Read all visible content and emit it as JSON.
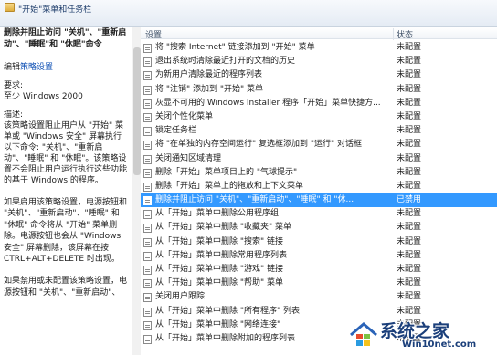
{
  "breadcrumb": {
    "title": "\"开始\"菜单和任务栏"
  },
  "description": {
    "heading": "删除并阻止访问 \"关机\"、\"重新启动\"、\"睡眠\"和 \"休眠\"命令",
    "edit_prefix": "编辑",
    "edit_link": "策略设置",
    "requirements_label": "要求:",
    "requirements_value": "至少 Windows 2000",
    "description_label": "描述:",
    "description_text": "该策略设置阻止用户从 \"开始\" 菜单或 \"Windows 安全\" 屏幕执行以下命令: \"关机\"、\"重新启动\"、\"睡眠\" 和 \"休眠\"。该策略设置不会阻止用户运行执行这些功能的基于 Windows 的程序。",
    "enable_text": "如果启用该策略设置，电源按钮和 \"关机\"、\"重新启动\"、\"睡眠\" 和 \"休眠\" 命令将从 \"开始\" 菜单删除。电源按钮也会从 \"Windows 安全\" 屏幕删除，该屏幕在按 CTRL+ALT+DELETE 时出现。",
    "disable_text": "如果禁用或未配置该策略设置，电源按钮和 \"关机\"、\"重新启动\"、"
  },
  "table": {
    "header_setting": "设置",
    "header_state": "状态",
    "rows": [
      {
        "name": "将 \"搜索 Internet\" 链接添加到 \"开始\" 菜单",
        "state": "未配置"
      },
      {
        "name": "退出系统时清除最近打开的文档的历史",
        "state": "未配置"
      },
      {
        "name": "为新用户清除最近的程序列表",
        "state": "未配置"
      },
      {
        "name": "将 \"注销\" 添加到 \"开始\" 菜单",
        "state": "未配置"
      },
      {
        "name": "灰显不可用的 Windows Installer 程序「开始」菜单快捷方...",
        "state": "未配置"
      },
      {
        "name": "关闭个性化菜单",
        "state": "未配置"
      },
      {
        "name": "锁定任务栏",
        "state": "未配置"
      },
      {
        "name": "将 \"在单独的内存空间运行\" 复选框添加到 \"运行\" 对话框",
        "state": "未配置"
      },
      {
        "name": "关闭通知区域清理",
        "state": "未配置"
      },
      {
        "name": "删除「开始」菜单项目上的 \"气球提示\"",
        "state": "未配置"
      },
      {
        "name": "删除「开始」菜单上的拖放和上下文菜单",
        "state": "未配置"
      },
      {
        "name": "删除并阻止访问 \"关机\"、\"重新启动\"、\"睡眠\" 和 \"休...",
        "state": "已禁用"
      },
      {
        "name": "从「开始」菜单中删除公用程序组",
        "state": "未配置"
      },
      {
        "name": "从「开始」菜单中删除 \"收藏夹\" 菜单",
        "state": "未配置"
      },
      {
        "name": "从「开始」菜单中删除 \"搜索\" 链接",
        "state": "未配置"
      },
      {
        "name": "从「开始」菜单中删除常用程序列表",
        "state": "未配置"
      },
      {
        "name": "从「开始」菜单中删除 \"游戏\" 链接",
        "state": "未配置"
      },
      {
        "name": "从「开始」菜单中删除 \"帮助\" 菜单",
        "state": "未配置"
      },
      {
        "name": "关闭用户跟踪",
        "state": "未配置"
      },
      {
        "name": "从「开始」菜单中删除 \"所有程序\" 列表",
        "state": "未配置"
      },
      {
        "name": "从「开始」菜单中删除 \"网络连接\"",
        "state": "未配置"
      },
      {
        "name": "从「开始」菜单中删除附加的程序列表",
        "state": "未配置"
      }
    ],
    "selected_index": 11
  },
  "watermark": {
    "title": "系统之家",
    "url": "Win10net.com"
  },
  "colors": {
    "selection": "#3399ff",
    "link": "#0d4fb4",
    "watermark": "#1b3f7a"
  }
}
